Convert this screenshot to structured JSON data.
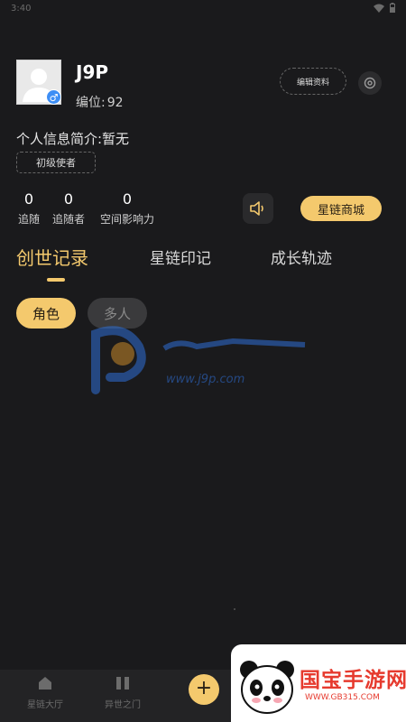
{
  "status_bar": {
    "time": "3:40"
  },
  "profile": {
    "username": "J9P",
    "id_label": "编位:",
    "id_value": "92",
    "edit_label": "编辑资料",
    "bio": "个人信息简介:暂无",
    "level": "初级使者"
  },
  "stats": [
    {
      "value": "0",
      "label": "追随"
    },
    {
      "value": "0",
      "label": "追随者"
    },
    {
      "value": "0",
      "label": "空间影响力"
    }
  ],
  "shop_label": "星链商城",
  "tabs": [
    {
      "label": "创世记录"
    },
    {
      "label": "星链印记"
    },
    {
      "label": "成长轨迹"
    }
  ],
  "chips": [
    {
      "label": "角色"
    },
    {
      "label": "多人"
    }
  ],
  "bottom_nav": [
    {
      "label": "星链大厅",
      "icon": "home-icon"
    },
    {
      "label": "异世之门",
      "icon": "gate-icon"
    }
  ],
  "add_label": "+",
  "watermarks": {
    "center_url": "www.j9p.com",
    "corner_title": "国宝手游网",
    "corner_url": "WWW.GB315.COM"
  },
  "colors": {
    "background": "#1a1a1c",
    "accent": "#f4c96d",
    "gender_badge": "#3d8ef5"
  }
}
